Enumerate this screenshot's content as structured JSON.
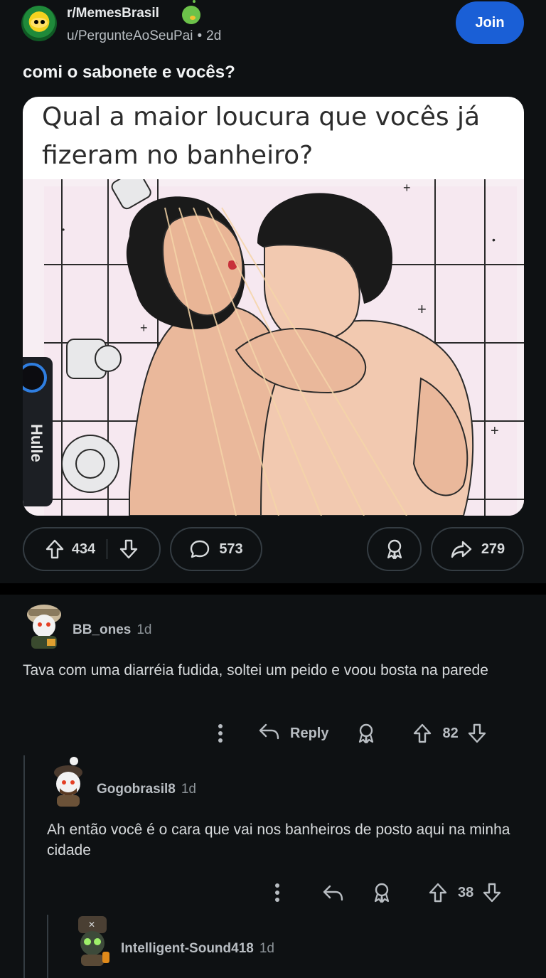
{
  "post": {
    "subreddit": "r/MemesBrasil",
    "author": "u/PergunteAoSeuPai",
    "separator": "•",
    "age": "2d",
    "join_label": "Join",
    "title": "comi o sabonete e vocês?",
    "image": {
      "caption": "Qual a maior loucura que vocês já fizeram no banheiro?",
      "overlay_label": "Hulle"
    },
    "upvotes": "434",
    "comments": "573",
    "shares": "279"
  },
  "comments": [
    {
      "username": "BB_ones",
      "age": "1d",
      "body": "Tava com uma diarréia fudida, soltei um peido e voou bosta na parede",
      "reply_label": "Reply",
      "score": "82"
    },
    {
      "username": "Gogobrasil8",
      "age": "1d",
      "body": "Ah então você é o cara que vai nos banheiros de posto aqui na minha cidade",
      "score": "38"
    },
    {
      "username": "Intelligent-Sound418",
      "age": "1d"
    }
  ],
  "colors": {
    "background": "#0e1113",
    "join_button": "#1a5fd6",
    "pill_border": "#343c42",
    "text_primary": "#d7dadc"
  },
  "icons": [
    "upvote-icon",
    "downvote-icon",
    "comment-icon",
    "award-icon",
    "share-icon",
    "reply-icon",
    "more-icon"
  ]
}
